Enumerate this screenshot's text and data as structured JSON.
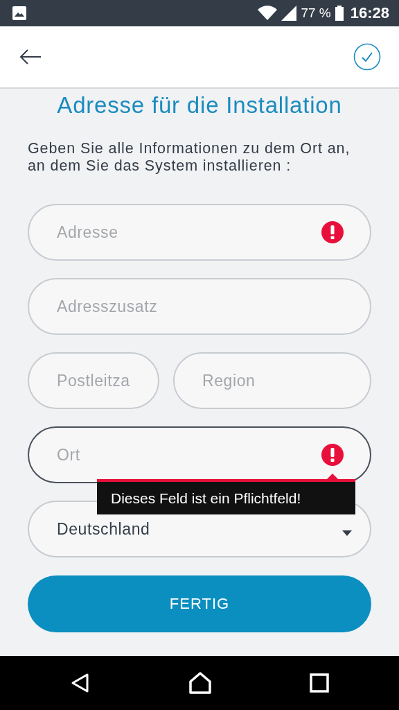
{
  "status_bar": {
    "battery": "77 %",
    "time": "16:28"
  },
  "title": "Adresse für die Installation",
  "instructions": "Geben Sie alle Informationen zu dem Ort an, an dem Sie das System installieren :",
  "form_rows": [
    {
      "fields": [
        {
          "kind": "text",
          "placeholder": "Adresse",
          "error": true,
          "focused": false
        }
      ]
    },
    {
      "fields": [
        {
          "kind": "text",
          "placeholder": "Adresszusatz",
          "error": false,
          "focused": false
        }
      ]
    },
    {
      "fields": [
        {
          "kind": "text",
          "placeholder": "Postleitza",
          "error": false,
          "focused": false
        },
        {
          "kind": "text",
          "placeholder": "Region",
          "error": false,
          "focused": false
        }
      ]
    },
    {
      "fields": [
        {
          "kind": "text",
          "placeholder": "Ort",
          "error": true,
          "focused": true,
          "error_message": "Dieses Feld ist ein Pflichtfeld!"
        }
      ]
    },
    {
      "fields": [
        {
          "kind": "select",
          "value": "Deutschland",
          "error": false,
          "focused": false
        }
      ]
    }
  ],
  "submit_button": "FERTIG"
}
